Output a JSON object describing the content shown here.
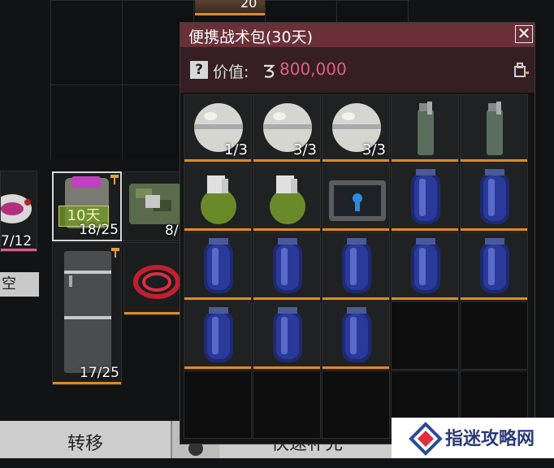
{
  "background": {
    "top_item_count": "20",
    "items": [
      {
        "name": "helmet",
        "count": "7/12"
      },
      {
        "name": "backpack",
        "badge": "10天",
        "count": "18/25"
      },
      {
        "name": "camo-case",
        "count": "8/"
      },
      {
        "name": "locker",
        "count": "17/25"
      }
    ],
    "empty_label": "空"
  },
  "panel": {
    "title": "便携战术包(30天)",
    "close": "✕",
    "value_label": "价值:",
    "value_amount": "800,000",
    "question_mark": "?"
  },
  "grid_items": [
    {
      "item": "white-sphere-grenade",
      "count": "1/3"
    },
    {
      "item": "white-sphere-grenade",
      "count": "3/3"
    },
    {
      "item": "white-sphere-grenade",
      "count": "3/3"
    },
    {
      "item": "smoke-grenade",
      "count": ""
    },
    {
      "item": "smoke-grenade",
      "count": ""
    },
    {
      "item": "green-frag-grenade",
      "count": ""
    },
    {
      "item": "green-frag-grenade",
      "count": ""
    },
    {
      "item": "tablet-device",
      "count": ""
    },
    {
      "item": "blue-canister",
      "count": ""
    },
    {
      "item": "blue-canister",
      "count": ""
    },
    {
      "item": "blue-canister",
      "count": ""
    },
    {
      "item": "blue-canister",
      "count": ""
    },
    {
      "item": "blue-canister",
      "count": ""
    },
    {
      "item": "blue-canister",
      "count": ""
    },
    {
      "item": "blue-canister",
      "count": ""
    },
    {
      "item": "blue-canister",
      "count": ""
    },
    {
      "item": "blue-canister",
      "count": ""
    },
    {
      "item": "blue-canister",
      "count": ""
    }
  ],
  "bottom_bar": {
    "transfer": "转移",
    "quick": "快速补充"
  },
  "watermark": {
    "text": "指迷攻略网"
  },
  "colors": {
    "accent_orange": "#e08a20",
    "value_pink": "#e05e8c",
    "header": "#6a3038"
  }
}
